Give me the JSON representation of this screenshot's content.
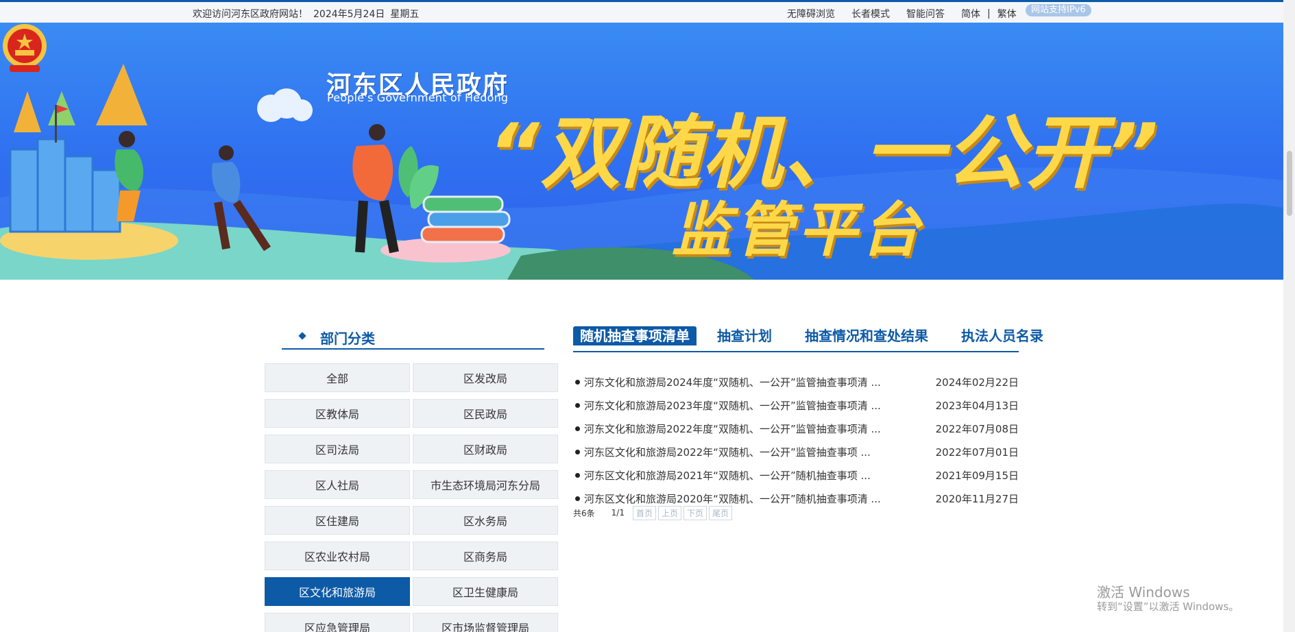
{
  "topbar": {
    "welcome": "欢迎访问河东区政府网站！",
    "date": "2024年5月24日",
    "weekday": "星期五",
    "links": {
      "accessible": "无障碍浏览",
      "elder": "长者模式",
      "qa": "智能问答",
      "simplified": "简体",
      "separator": "|",
      "traditional": "繁体"
    },
    "ipv6": "网站支持IPv6"
  },
  "banner": {
    "gov_name": "河东区人民政府",
    "gov_name_en": "People's Government of Hedong",
    "title_line1": "“双随机、一公开”",
    "title_line2": "监管平台"
  },
  "departments": {
    "title": "部门分类",
    "items": [
      {
        "label": "全部",
        "active": false
      },
      {
        "label": "区发改局",
        "active": false
      },
      {
        "label": "区教体局",
        "active": false
      },
      {
        "label": "区民政局",
        "active": false
      },
      {
        "label": "区司法局",
        "active": false
      },
      {
        "label": "区财政局",
        "active": false
      },
      {
        "label": "区人社局",
        "active": false
      },
      {
        "label": "市生态环境局河东分局",
        "active": false
      },
      {
        "label": "区住建局",
        "active": false
      },
      {
        "label": "区水务局",
        "active": false
      },
      {
        "label": "区农业农村局",
        "active": false
      },
      {
        "label": "区商务局",
        "active": false
      },
      {
        "label": "区文化和旅游局",
        "active": true
      },
      {
        "label": "区卫生健康局",
        "active": false
      },
      {
        "label": "区应急管理局",
        "active": false
      },
      {
        "label": "区市场监督管理局",
        "active": false
      }
    ]
  },
  "tabs": [
    {
      "label": "随机抽查事项清单",
      "active": true
    },
    {
      "label": "抽查计划",
      "active": false
    },
    {
      "label": "抽查情况和查处结果",
      "active": false
    },
    {
      "label": "执法人员名录",
      "active": false
    }
  ],
  "list": [
    {
      "title": "河东文化和旅游局2024年度“双随机、一公开”监管抽查事项清 ...",
      "date": "2024年02月22日"
    },
    {
      "title": "河东文化和旅游局2023年度“双随机、一公开”监管抽查事项清 ...",
      "date": "2023年04月13日"
    },
    {
      "title": "河东文化和旅游局2022年度“双随机、一公开”监管抽查事项清 ...",
      "date": "2022年07月08日"
    },
    {
      "title": "河东区文化和旅游局2022年“双随机、一公开”监管抽查事项 ...",
      "date": "2022年07月01日"
    },
    {
      "title": "河东区文化和旅游局2021年“双随机、一公开”随机抽查事项 ...",
      "date": "2021年09月15日"
    },
    {
      "title": "河东区文化和旅游局2020年“双随机、一公开”随机抽查事项清 ...",
      "date": "2020年11月27日"
    }
  ],
  "pager": {
    "count": "共6条",
    "pages": "1/1",
    "first": "首页",
    "prev": "上页",
    "next": "下页",
    "last": "尾页"
  },
  "watermark": {
    "line1": "激活 Windows",
    "line2": "转到“设置”以激活 Windows。"
  },
  "colors": {
    "primary": "#0d5aa7",
    "banner_blue": "#2f6ff0",
    "title_yellow": "#ffd84a"
  }
}
